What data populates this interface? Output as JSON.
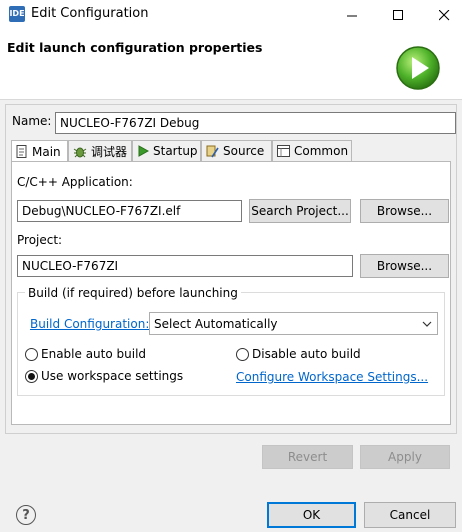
{
  "window": {
    "app_icon_text": "IDE",
    "title": "Edit Configuration"
  },
  "banner": {
    "title": "Edit launch configuration properties",
    "icon": "run-play-icon"
  },
  "name": {
    "label": "Name:",
    "value": "NUCLEO-F767ZI Debug"
  },
  "tabs": [
    {
      "label": "Main",
      "icon": "main-page-icon",
      "active": true
    },
    {
      "label": "调试器",
      "icon": "debugger-bug-icon",
      "active": false
    },
    {
      "label": "Startup",
      "icon": "startup-play-icon",
      "active": false
    },
    {
      "label": "Source",
      "icon": "source-icon",
      "active": false
    },
    {
      "label": "Common",
      "icon": "common-table-icon",
      "active": false
    }
  ],
  "main": {
    "app_label": "C/C++ Application:",
    "app_value": "Debug\\NUCLEO-F767ZI.elf",
    "search_project": "Search Project...",
    "browse1": "Browse...",
    "project_label": "Project:",
    "project_value": "NUCLEO-F767ZI",
    "browse2": "Browse...",
    "group_title": "Build (if required) before launching",
    "build_config_link": "Build Configuration:",
    "build_config_value": "Select Automatically",
    "enable_auto_build": "Enable auto build",
    "disable_auto_build": "Disable auto build",
    "use_workspace": "Use workspace settings",
    "configure_link": "Configure Workspace Settings..."
  },
  "buttons": {
    "revert": "Revert",
    "apply": "Apply",
    "ok": "OK",
    "cancel": "Cancel"
  },
  "help": "?"
}
